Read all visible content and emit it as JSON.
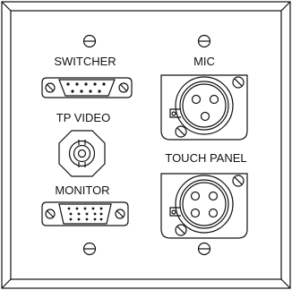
{
  "labels": {
    "switcher": "SWITCHER",
    "tp_video": "TP VIDEO",
    "monitor": "MONITOR",
    "mic": "MIC",
    "touch_panel": "TOUCH PANEL"
  },
  "connectors": {
    "switcher": "db9-connector-icon",
    "tp_video": "bnc-connector-icon",
    "monitor": "hd15-vga-connector-icon",
    "mic": "xlr-3pin-connector-icon",
    "touch_panel": "xlr-4pin-connector-icon"
  },
  "colors": {
    "line": "#111111",
    "plate": "#ffffff"
  }
}
